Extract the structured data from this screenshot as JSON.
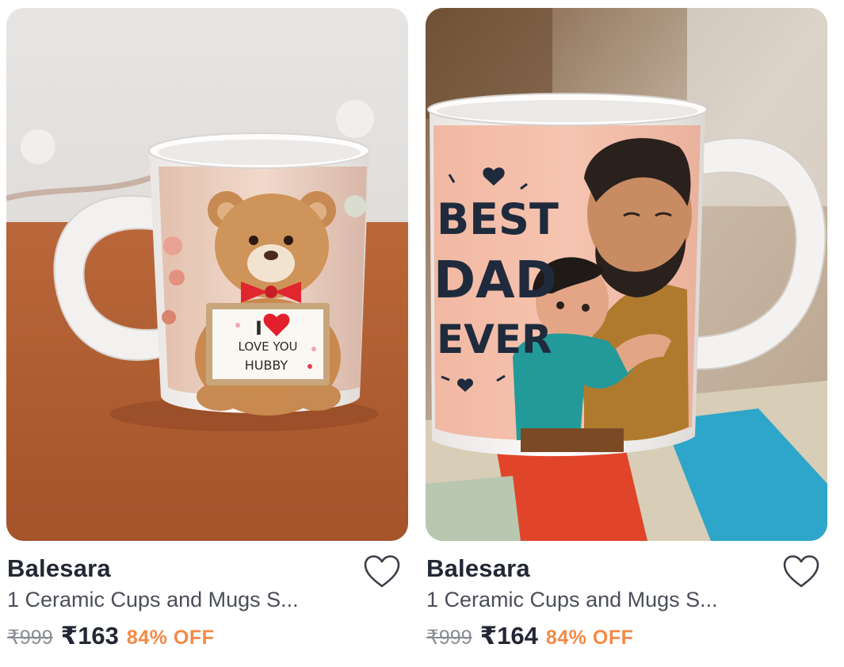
{
  "products": [
    {
      "brand": "Balesara",
      "title": "1 Ceramic Cups and Mugs S...",
      "mrp": "₹999",
      "price": "₹163",
      "discount": "84% OFF",
      "image": {
        "alt": "Ceramic mug with teddy bear holding I love you hubby sign",
        "sign_line_1": "I",
        "sign_line_2": "LOVE YOU",
        "sign_line_3": "HUBBY"
      }
    },
    {
      "brand": "Balesara",
      "title": "1 Ceramic Cups and Mugs S...",
      "mrp": "₹999",
      "price": "₹164",
      "discount": "84% OFF",
      "image": {
        "alt": "Ceramic mug with father hugging child illustration and Best Dad Ever text",
        "text_line_1": "BEST",
        "text_line_2": "DAD",
        "text_line_3": "EVER"
      }
    }
  ],
  "colors": {
    "brand_text": "#232735",
    "title_text": "#4a4e58",
    "mrp_text": "#8a8d94",
    "discount": "#f28a47",
    "heart_outline": "#3a3e47"
  },
  "icons": {
    "wishlist": "heart-outline-icon"
  }
}
